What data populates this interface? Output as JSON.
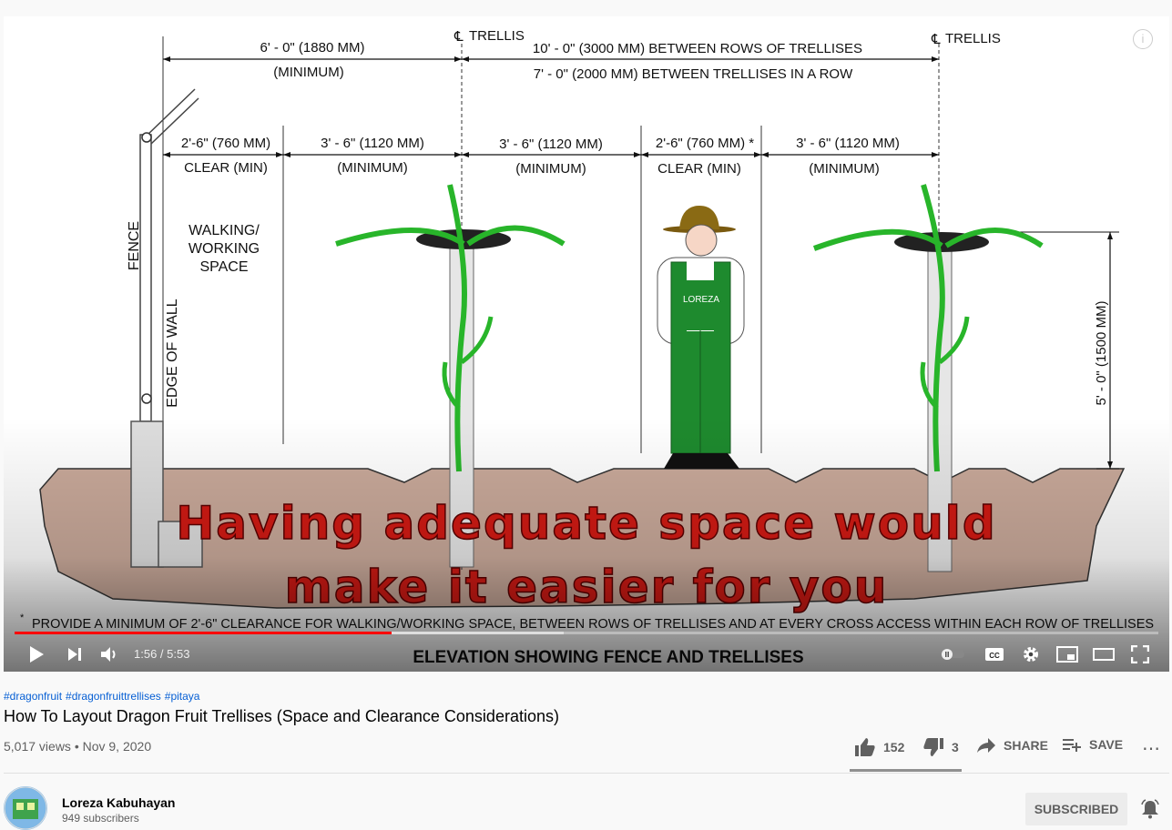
{
  "video": {
    "drawing": {
      "top_dims": {
        "d1": "6' - 0\" (1880 MM)",
        "d1_sub": "(MINIMUM)",
        "d2": "10' - 0\" (3000 MM) BETWEEN ROWS OF TRELLISES",
        "d2_sub": "7' - 0\" (2000 MM) BETWEEN TRELLISES IN A ROW",
        "cl1": "TRELLIS",
        "cl2": "TRELLIS"
      },
      "mid_dims": [
        {
          "top": "2'-6\" (760 MM)",
          "bottom": "CLEAR (MIN)"
        },
        {
          "top": "3' - 6\" (1120 MM)",
          "bottom": "(MINIMUM)"
        },
        {
          "top": "3' - 6\" (1120 MM)",
          "bottom": "(MINIMUM)"
        },
        {
          "top": "2'-6\" (760 MM) *",
          "bottom": "CLEAR (MIN)"
        },
        {
          "top": "3' - 6\" (1120 MM)",
          "bottom": "(MINIMUM)"
        }
      ],
      "walking_space": [
        "WALKING/",
        "WORKING",
        "SPACE"
      ],
      "fence_label": "FENCE",
      "wall_label": "EDGE OF WALL",
      "height_label": "5' - 0\" (1500 MM)",
      "person_badge": "LOREZA",
      "footnote_star": "*",
      "footnote": "PROVIDE A MINIMUM OF 2'-6\" CLEARANCE FOR WALKING/WORKING SPACE, BETWEEN ROWS OF TRELLISES AND AT EVERY CROSS ACCESS WITHIN EACH ROW OF TRELLISES",
      "drawing_title": "ELEVATION SHOWING FENCE AND TRELLISES"
    },
    "caption": {
      "line1": "Having adequate space would",
      "line2": "make it easier for you"
    },
    "controls": {
      "time": "1:56 / 5:53",
      "progress": 0.33,
      "info": "i",
      "cc": "CC"
    }
  },
  "hashtags": [
    "#dragonfruit",
    "#dragonfruittrellises",
    "#pitaya"
  ],
  "title": "How To Layout Dragon Fruit Trellises (Space and Clearance Considerations)",
  "meta": "5,017 views • Nov 9, 2020",
  "actions": {
    "likes": "152",
    "dislikes": "3",
    "share": "SHARE",
    "save": "SAVE",
    "like_ratio": 0.98
  },
  "channel": {
    "name": "Loreza Kabuhayan",
    "subscribers": "949 subscribers",
    "subscribe_label": "SUBSCRIBED"
  },
  "colors": {
    "caption_red": "#d11a14",
    "progress_red": "#ff0000",
    "person_green": "#1e8a2e",
    "link_blue": "#065fd4"
  }
}
